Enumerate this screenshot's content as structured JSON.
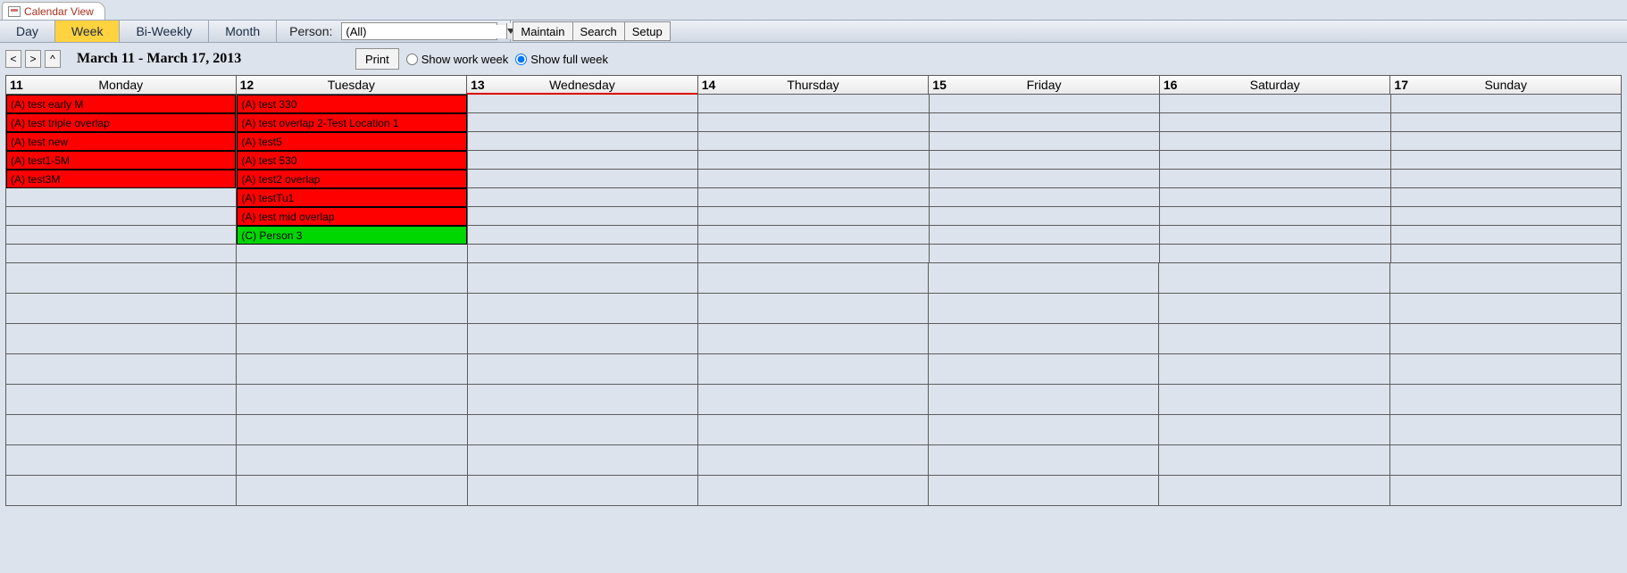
{
  "tab": {
    "title": "Calendar View"
  },
  "views": {
    "day": "Day",
    "week": "Week",
    "biweekly": "Bi-Weekly",
    "month": "Month",
    "active": "week"
  },
  "person": {
    "label": "Person:",
    "value": "(All)"
  },
  "toolbar": {
    "maintain": "Maintain",
    "search": "Search",
    "setup": "Setup"
  },
  "nav": {
    "prev": "<",
    "next": ">",
    "up": "^",
    "range": "March 11 - March 17, 2013",
    "print": "Print",
    "work_week": "Show work week",
    "full_week": "Show full week",
    "mode": "full"
  },
  "days": [
    {
      "num": "11",
      "name": "Monday"
    },
    {
      "num": "12",
      "name": "Tuesday"
    },
    {
      "num": "13",
      "name": "Wednesday"
    },
    {
      "num": "14",
      "name": "Thursday"
    },
    {
      "num": "15",
      "name": "Friday"
    },
    {
      "num": "16",
      "name": "Saturday"
    },
    {
      "num": "17",
      "name": "Sunday"
    }
  ],
  "events": {
    "mon": [
      {
        "text": "(A) test early M",
        "color": "red"
      },
      {
        "text": "(A) test triple overlap",
        "color": "red"
      },
      {
        "text": "(A) test new",
        "color": "red"
      },
      {
        "text": "(A) test1-5M",
        "color": "red"
      },
      {
        "text": "(A) test3M",
        "color": "red"
      }
    ],
    "tue": [
      {
        "text": "(A) test 330",
        "color": "red"
      },
      {
        "text": "(A) test overlap 2-Test Location 1",
        "color": "red"
      },
      {
        "text": "(A) test5",
        "color": "red"
      },
      {
        "text": "(A) test 530",
        "color": "red"
      },
      {
        "text": "(A) test2 overlap",
        "color": "red"
      },
      {
        "text": "(A) testTu1",
        "color": "red"
      },
      {
        "text": "(A) test mid overlap",
        "color": "red"
      },
      {
        "text": "(C) Person 3",
        "color": "green"
      }
    ]
  },
  "slot_rows": 9,
  "lower_rows": 8
}
